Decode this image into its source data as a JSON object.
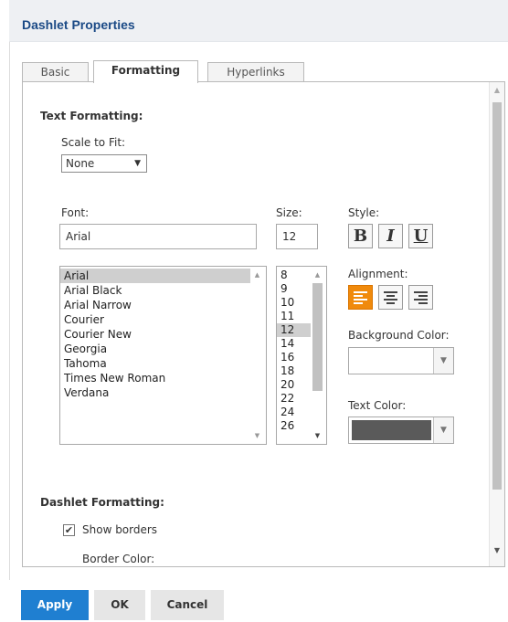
{
  "dialog": {
    "title": "Dashlet Properties"
  },
  "tabs": [
    {
      "label": "Basic"
    },
    {
      "label": "Formatting"
    },
    {
      "label": "Hyperlinks"
    }
  ],
  "text_formatting": {
    "title": "Text Formatting:",
    "scale_label": "Scale to Fit:",
    "scale_value": "None",
    "font_label": "Font:",
    "font_value": "Arial",
    "size_label": "Size:",
    "size_value": "12",
    "style_label": "Style:",
    "style_buttons": {
      "bold": "B",
      "italic": "I",
      "underline": "U"
    },
    "fonts": [
      "Arial",
      "Arial Black",
      "Arial Narrow",
      "Courier",
      "Courier New",
      "Georgia",
      "Tahoma",
      "Times New Roman",
      "Verdana"
    ],
    "sizes": [
      "8",
      "9",
      "10",
      "11",
      "12",
      "14",
      "16",
      "18",
      "20",
      "22",
      "24",
      "26"
    ],
    "alignment_label": "Alignment:",
    "bg_color_label": "Background Color:",
    "text_color_label": "Text Color:",
    "bg_color": "#ffffff",
    "text_color": "#5a5a5a",
    "accent": "#f08a0c"
  },
  "dashlet_formatting": {
    "title": "Dashlet Formatting:",
    "show_borders_label": "Show borders",
    "border_color_label": "Border Color:"
  },
  "footer": {
    "apply": "Apply",
    "ok": "OK",
    "cancel": "Cancel"
  }
}
